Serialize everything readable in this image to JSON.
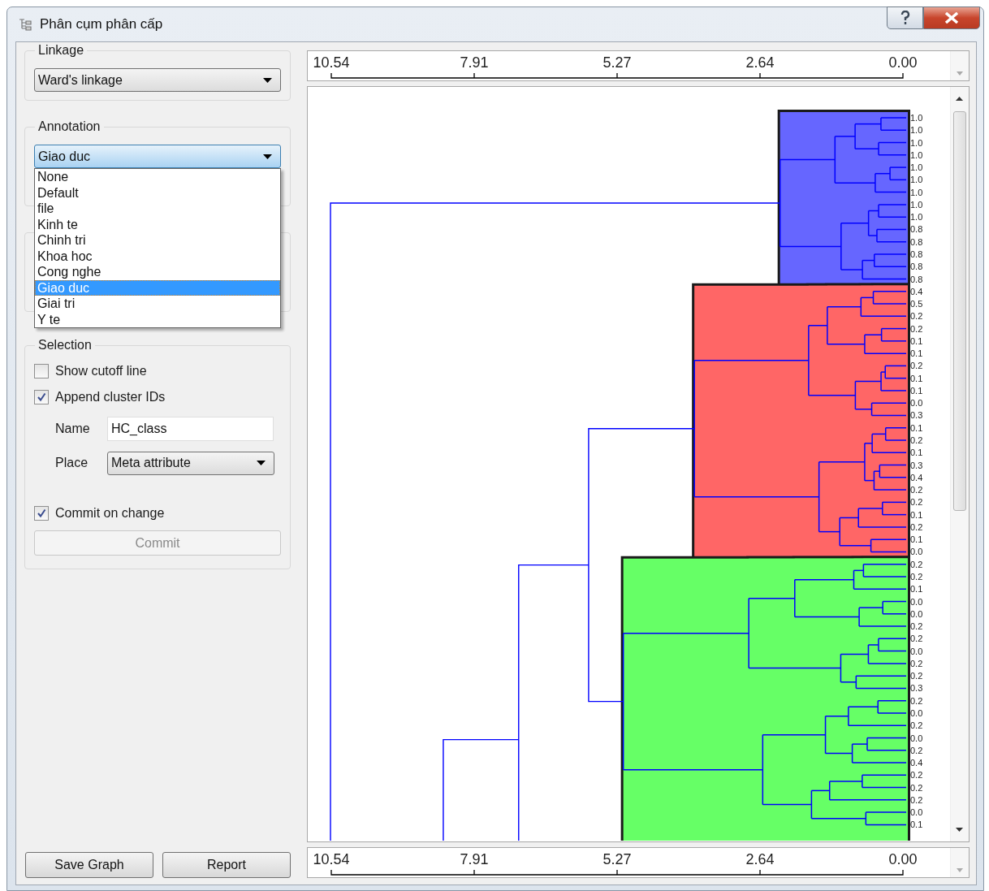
{
  "window": {
    "title": "Phân cụm phân cấp"
  },
  "linkage": {
    "label": "Linkage",
    "value": "Ward's linkage"
  },
  "annotation": {
    "label": "Annotation",
    "value": "Giao duc",
    "expanded": true,
    "options": [
      {
        "label": "None",
        "selected": false
      },
      {
        "label": "Default",
        "selected": false
      },
      {
        "label": "file",
        "selected": false
      },
      {
        "label": "Kinh te",
        "selected": false
      },
      {
        "label": "Chinh tri",
        "selected": false
      },
      {
        "label": "Khoa hoc",
        "selected": false
      },
      {
        "label": "Cong nghe",
        "selected": false
      },
      {
        "label": "Giao duc",
        "selected": true
      },
      {
        "label": "Giai tri",
        "selected": false
      },
      {
        "label": "Y te",
        "selected": false
      }
    ]
  },
  "selection": {
    "label": "Selection",
    "show_cutoff": {
      "label": "Show cutoff line",
      "checked": false
    },
    "append_ids": {
      "label": "Append cluster IDs",
      "checked": true
    },
    "name": {
      "label": "Name",
      "value": "HC_class"
    },
    "place": {
      "label": "Place",
      "value": "Meta attribute"
    },
    "commit_on_change": {
      "label": "Commit on change",
      "checked": true
    },
    "commit_button": {
      "label": "Commit",
      "disabled": true
    }
  },
  "buttons": [
    "Save Graph",
    "Report"
  ],
  "axis_top": {
    "ticks": [
      "10.54",
      "7.91",
      "5.27",
      "2.64",
      "0.00"
    ]
  },
  "axis_bottom": {
    "ticks": [
      "10.54",
      "7.91",
      "5.27",
      "2.64",
      "0.00"
    ]
  },
  "clusters": [
    {
      "color": "#6666ff",
      "leaves": [
        "1.0",
        "1.0",
        "1.0",
        "1.0",
        "1.0",
        "1.0",
        "1.0",
        "1.0",
        "1.0",
        "0.8",
        "0.8",
        "0.8",
        "0.8",
        "0.8"
      ]
    },
    {
      "color": "#ff6666",
      "leaves": [
        "0.4",
        "0.5",
        "0.2",
        "0.2",
        "0.1",
        "0.1",
        "0.2",
        "0.1",
        "0.1",
        "0.0",
        "0.3",
        "0.1",
        "0.2",
        "0.1",
        "0.3",
        "0.4",
        "0.2",
        "0.2",
        "0.1",
        "0.2",
        "0.1",
        "0.0"
      ]
    },
    {
      "color": "#66ff66",
      "leaves": [
        "0.2",
        "0.2",
        "0.1",
        "0.0",
        "0.0",
        "0.2",
        "0.2",
        "0.0",
        "0.2",
        "0.2",
        "0.3",
        "0.2",
        "0.0",
        "0.2",
        "0.0",
        "0.2",
        "0.4",
        "0.2",
        "0.2",
        "0.2",
        "0.0",
        "0.1"
      ]
    }
  ]
}
